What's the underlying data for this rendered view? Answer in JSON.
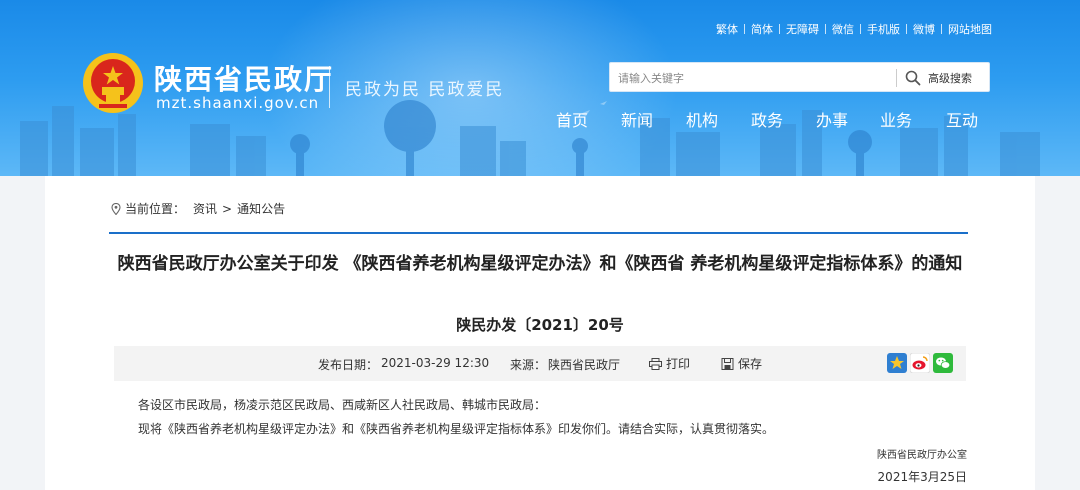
{
  "header": {
    "site_title": "陕西省民政厅",
    "domain": "mzt.shaanxi.gov.cn",
    "slogan": "民政为民  民政爱民",
    "top_links": [
      "繁体",
      "简体",
      "无障碍",
      "微信",
      "手机版",
      "微博",
      "网站地图"
    ],
    "search": {
      "placeholder": "请输入关键字",
      "advanced_label": "高级搜索"
    },
    "nav": [
      "首页",
      "新闻",
      "机构",
      "政务",
      "办事",
      "业务",
      "互动"
    ]
  },
  "breadcrumb": {
    "label": "当前位置：",
    "items": [
      "资讯",
      "通知公告"
    ],
    "separator": ">"
  },
  "article": {
    "title": "陕西省民政厅办公室关于印发 《陕西省养老机构星级评定办法》和《陕西省 养老机构星级评定指标体系》的通知",
    "doc_number": "陕民办发〔2021〕20号",
    "meta": {
      "date_label": "发布日期：",
      "date": "2021-03-29 12:30",
      "source_label": "来源：",
      "source": "陕西省民政厅",
      "print_label": "打印",
      "save_label": "保存"
    },
    "paragraphs": [
      "各设区市民政局，杨凌示范区民政局、西咸新区人社民政局、韩城市民政局：",
      "现将《陕西省养老机构星级评定办法》和《陕西省养老机构星级评定指标体系》印发你们。请结合实际，认真贯彻落实。"
    ],
    "signature_org": "陕西省民政厅办公室",
    "signature_date": "2021年3月25日"
  },
  "colors": {
    "header_blue": "#1a8ae8",
    "breadcrumb_line": "#1a6fc9",
    "page_bg": "#f2f4f7"
  },
  "icons": [
    "national-emblem-icon",
    "search-icon",
    "location-pin-icon",
    "printer-icon",
    "save-icon",
    "share-favorite-icon",
    "weibo-icon",
    "wechat-icon"
  ]
}
